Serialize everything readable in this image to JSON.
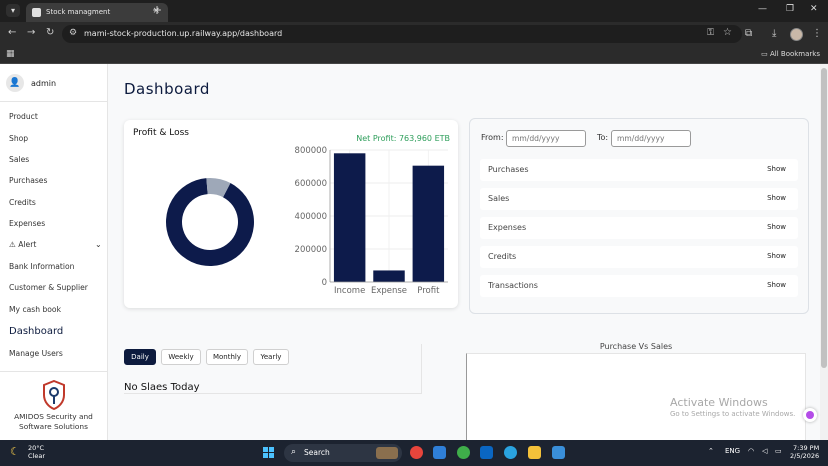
{
  "browser": {
    "tab_title": "Stock managment",
    "url": "mami-stock-production.up.railway.app/dashboard",
    "all_bookmarks": "All Bookmarks"
  },
  "sidebar": {
    "user": "admin",
    "items": [
      {
        "id": "product",
        "label": "Product"
      },
      {
        "id": "shop",
        "label": "Shop"
      },
      {
        "id": "sales",
        "label": "Sales"
      },
      {
        "id": "purchases",
        "label": "Purchases"
      },
      {
        "id": "credits",
        "label": "Credits"
      },
      {
        "id": "expenses",
        "label": "Expenses"
      },
      {
        "id": "alert",
        "label": "Alert"
      },
      {
        "id": "bank-information",
        "label": "Bank Information"
      },
      {
        "id": "customer-supplier",
        "label": "Customer & Supplier"
      },
      {
        "id": "my-cash-book",
        "label": "My cash book"
      },
      {
        "id": "dashboard",
        "label": "Dashboard",
        "active": true
      },
      {
        "id": "manage-users",
        "label": "Manage Users"
      }
    ],
    "company": "AMIDOS Security and Software Solutions"
  },
  "page_title": "Dashboard",
  "profit_loss": {
    "title": "Profit & Loss",
    "net_profit": "Net Profit: 763,960 ETB"
  },
  "chart_data": [
    {
      "type": "pie",
      "donut": true,
      "values": [
        0.91,
        0.09
      ],
      "colors": [
        "#0d1b4b",
        "#9ea8b8"
      ]
    },
    {
      "type": "bar",
      "categories": [
        "Income",
        "Expense",
        "Profit"
      ],
      "values": [
        780000,
        70000,
        705000
      ],
      "ylim": [
        0,
        800000
      ],
      "yticks": [
        "0",
        "200000",
        "400000",
        "600000",
        "800000"
      ],
      "grid": true,
      "color": "#0d1b4b"
    }
  ],
  "filter": {
    "from_label": "From:",
    "to_label": "To:",
    "date_placeholder": "mm/dd/yyyy",
    "rows": [
      {
        "label": "Purchases",
        "button": "Show"
      },
      {
        "label": "Sales",
        "button": "Show"
      },
      {
        "label": "Expenses",
        "button": "Show"
      },
      {
        "label": "Credits",
        "button": "Show"
      },
      {
        "label": "Transactions",
        "button": "Show"
      }
    ]
  },
  "sales_panel": {
    "periods": [
      "Daily",
      "Weekly",
      "Monthly",
      "Yearly"
    ],
    "active_period": "Daily",
    "empty_text": "No Slaes Today"
  },
  "purchase_vs_sales": {
    "title": "Purchase Vs Sales"
  },
  "watermark": {
    "title": "Activate Windows",
    "subtitle": "Go to Settings to activate Windows."
  },
  "taskbar": {
    "temp": "20°C",
    "weather": "Clear",
    "search": "Search",
    "lang": "ENG",
    "time": "7:39 PM",
    "date": "2/5/2026"
  }
}
